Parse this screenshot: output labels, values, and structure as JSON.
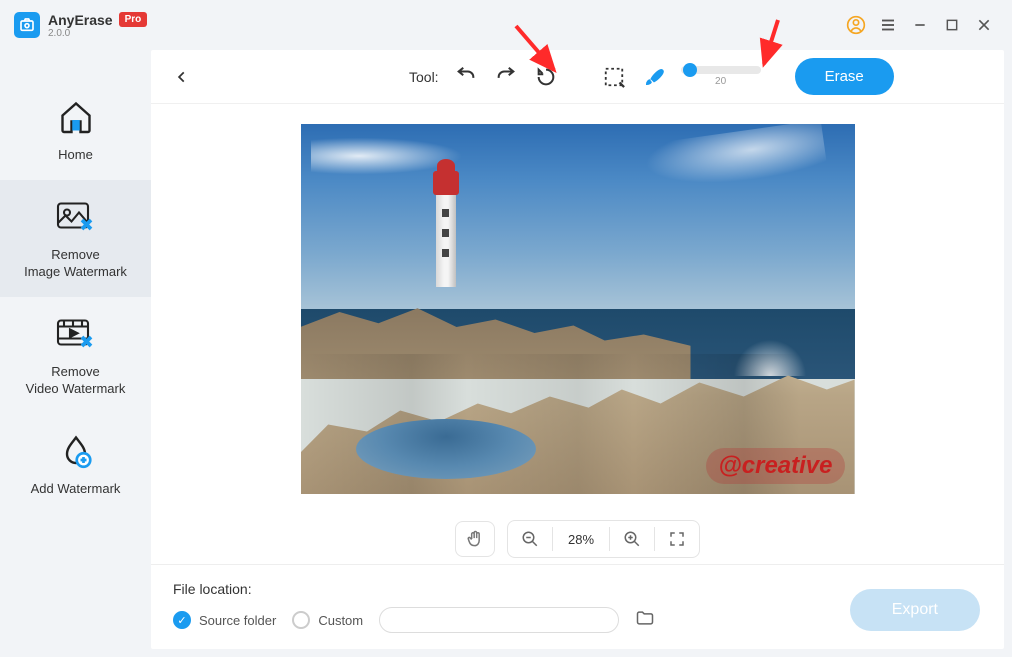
{
  "app": {
    "name": "AnyErase",
    "version": "2.0.0",
    "badge": "Pro"
  },
  "sidebar": {
    "items": [
      {
        "label": "Home"
      },
      {
        "label": "Remove\nImage Watermark"
      },
      {
        "label": "Remove\nVideo Watermark"
      },
      {
        "label": "Add Watermark"
      }
    ]
  },
  "toolbar": {
    "label": "Tool:",
    "brush_size": "20",
    "erase_label": "Erase"
  },
  "canvas": {
    "watermark_text": "@creative"
  },
  "zoom": {
    "value": "28%"
  },
  "footer": {
    "label": "File location:",
    "source_folder": "Source folder",
    "custom": "Custom",
    "export": "Export"
  }
}
